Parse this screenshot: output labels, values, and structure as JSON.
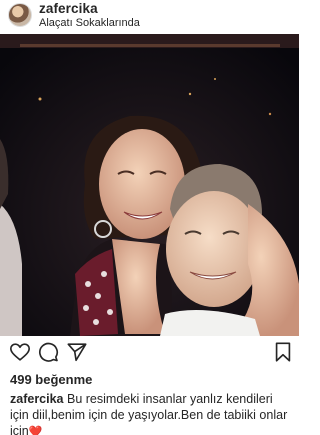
{
  "post": {
    "username": "zafercika",
    "location": "Alaçatı Sokaklarında",
    "likes": "499 beğenme",
    "caption": {
      "username": "zafercika",
      "text": "Bu resimdeki insanlar yanlız kendileri için diil,benim için de yaşıyolar.Ben de tabiiki onlar için",
      "emoji": "❤️"
    }
  },
  "icons": {
    "like": "heart-icon",
    "comment": "comment-icon",
    "share": "paper-plane-icon",
    "save": "bookmark-icon"
  },
  "colors": {
    "text": "#262626",
    "photo_background": "#0c0a10"
  }
}
